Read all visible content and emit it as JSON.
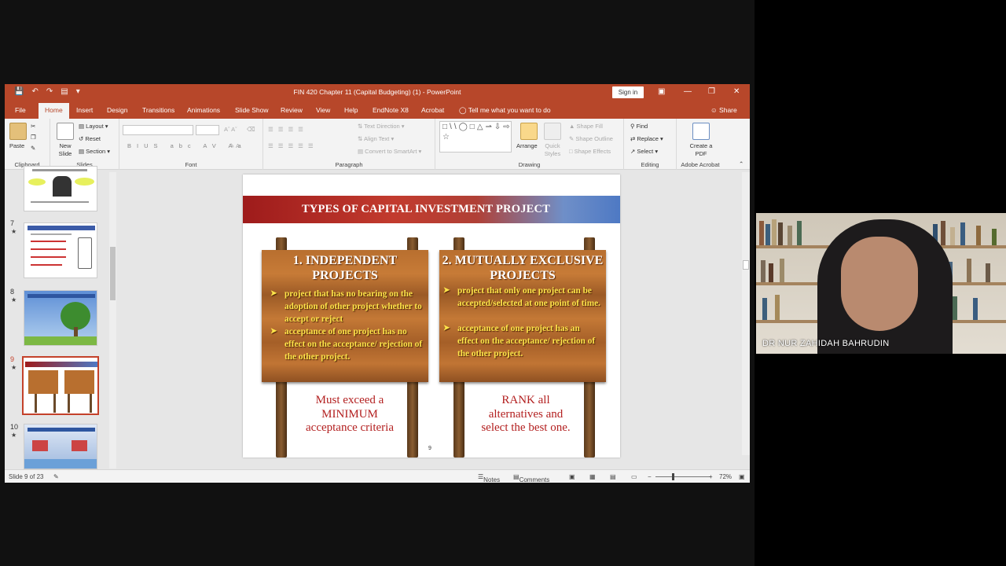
{
  "window": {
    "title": "FIN 420 Chapter 11 (Capital Budgeting) (1)  -  PowerPoint",
    "sign_in": "Sign in"
  },
  "tabs": [
    "File",
    "Home",
    "Insert",
    "Design",
    "Transitions",
    "Animations",
    "Slide Show",
    "Review",
    "Help",
    "EndNote X8",
    "Acrobat"
  ],
  "tell_me": "Tell me what you want to do",
  "share": "Share",
  "ribbon": {
    "clipboard": {
      "paste": "Paste",
      "label": "Clipboard"
    },
    "slides": {
      "new_slide": "New Slide",
      "layout": "Layout",
      "reset": "Reset",
      "section": "Section",
      "label": "Slides"
    },
    "font": {
      "label": "Font"
    },
    "paragraph": {
      "text_direction": "Text Direction",
      "align_text": "Align Text",
      "convert": "Convert to SmartArt",
      "label": "Paragraph"
    },
    "drawing": {
      "arrange": "Arrange",
      "quick_styles": "Quick Styles",
      "shape_fill": "Shape Fill",
      "shape_outline": "Shape Outline",
      "shape_effects": "Shape Effects",
      "label": "Drawing"
    },
    "editing": {
      "find": "Find",
      "replace": "Replace",
      "select": "Select",
      "label": "Editing"
    },
    "acrobat": {
      "create_pdf": "Create a PDF",
      "label": "Adobe Acrobat"
    }
  },
  "thumbnails": [
    {
      "num": "7"
    },
    {
      "num": "8"
    },
    {
      "num": "9"
    },
    {
      "num": "10"
    }
  ],
  "slide": {
    "title": "TYPES OF CAPITAL INVESTMENT PROJECT",
    "left_board": {
      "heading": "1. INDEPENDENT PROJECTS",
      "bullets": [
        "project that has no bearing on the adoption of other project whether to accept or reject",
        "acceptance of one project has no effect on the acceptance/ rejection of the other project."
      ],
      "caption": "Must exceed a MINIMUM acceptance criteria"
    },
    "right_board": {
      "heading": "2. MUTUALLY EXCLUSIVE PROJECTS",
      "bullets": [
        "project that only one project can be accepted/selected at one point of time.",
        "acceptance of one project has an effect on the acceptance/ rejection of the other project."
      ],
      "caption": "RANK all alternatives and select the best one."
    },
    "page_number": "9"
  },
  "status": {
    "slide_counter": "Slide 9 of 23",
    "notes": "Notes",
    "comments": "Comments",
    "zoom": "72%"
  },
  "webcam": {
    "name": "DR NUR ZAHIDAH BAHRUDIN"
  },
  "colors": {
    "accent": "#b7472a",
    "caption_red": "#b32020",
    "bullet_yellow": "#ffe54a"
  }
}
